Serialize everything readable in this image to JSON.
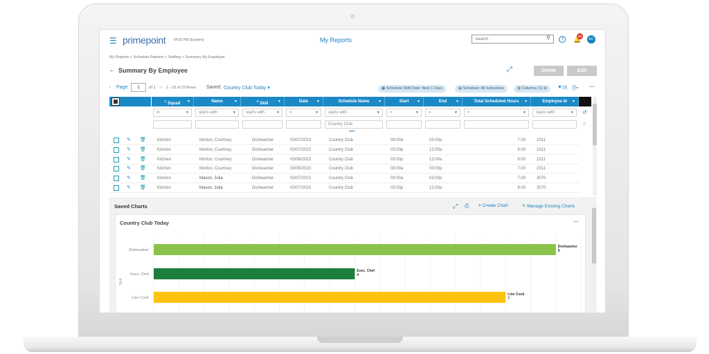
{
  "header": {
    "app_name": "primepoint",
    "time": "04:52 PM (Eastern)",
    "title": "My Reports",
    "search_placeholder": "Search",
    "notification_count": "99",
    "avatar": "KC"
  },
  "breadcrumb": [
    "My Reports",
    ">",
    "Schedule Reports",
    ">",
    "Staffing",
    ">",
    "Summary By Employee"
  ],
  "page": {
    "title": "Summary By Employee",
    "delete": "Delete",
    "edit": "Edit"
  },
  "toolbar": {
    "page_label": "Page",
    "page_value": "1",
    "of": "of 1",
    "rows": "1 - 23 of 23 Rows",
    "saved_label": "Saved:",
    "saved_value": "Country Club Today",
    "chips": [
      "Schedule Shift Date: Next 1 Days",
      "Schedule: All Schedules",
      "Columns (1)"
    ],
    "filter_count": "(3)"
  },
  "table": {
    "columns": [
      {
        "label": "Squad",
        "sort": "1"
      },
      {
        "label": "Name",
        "sort": ""
      },
      {
        "label": "Skill",
        "sort": "2"
      },
      {
        "label": "Date",
        "sort": ""
      },
      {
        "label": "Schedule Name",
        "sort": ""
      },
      {
        "label": "Start",
        "sort": ""
      },
      {
        "label": "End",
        "sort": ""
      },
      {
        "label": "Total Scheduled Hours",
        "sort": ""
      },
      {
        "label": "Employee Id",
        "sort": ""
      }
    ],
    "filter_ops": [
      "in",
      "starts with",
      "starts with",
      "=",
      "starts with",
      "=",
      "=",
      "=",
      "starts with"
    ],
    "filter_values": [
      "",
      "",
      "",
      "",
      "Country Club",
      "",
      "",
      "",
      ""
    ],
    "rows": [
      [
        "Kitchen",
        "Morton, Courtney",
        "Dishwasher",
        "03/07/2023",
        "Country Club",
        "08:00a",
        "03:00p",
        "7.00",
        "2311"
      ],
      [
        "Kitchen",
        "Morton, Courtney",
        "Dishwasher",
        "03/07/2023",
        "Country Club",
        "03:00p",
        "12:00a",
        "9.00",
        "2311"
      ],
      [
        "Kitchen",
        "Morton, Courtney",
        "Dishwasher",
        "03/08/2023",
        "Country Club",
        "03:00p",
        "12:00a",
        "9.00",
        "2311"
      ],
      [
        "Kitchen",
        "Morton, Courtney",
        "Dishwasher",
        "03/08/2023",
        "Country Club",
        "08:00a",
        "03:00p",
        "7.00",
        "2311"
      ],
      [
        "Kitchen",
        "Mason, Julia",
        "Dishwasher",
        "03/07/2023",
        "Country Club",
        "08:00a",
        "03:00p",
        "7.00",
        "3070"
      ],
      [
        "Kitchen",
        "Mason, Julia",
        "Dishwasher",
        "03/07/2023",
        "Country Club",
        "03:00p",
        "12:00a",
        "9.00",
        "3070"
      ]
    ]
  },
  "charts": {
    "section_title": "Saved Charts",
    "create": "Create Chart",
    "manage": "Manage Existing Charts"
  },
  "chart_data": {
    "type": "bar",
    "orientation": "horizontal",
    "title": "Country Club Today",
    "ylabel": "Skill",
    "categories": [
      "Dishwasher",
      "Exec. Chef",
      "Line Cook"
    ],
    "values": [
      8,
      4,
      7
    ],
    "colors": [
      "#8bc34a",
      "#1e7e3e",
      "#ffc20e"
    ],
    "grid": true
  }
}
